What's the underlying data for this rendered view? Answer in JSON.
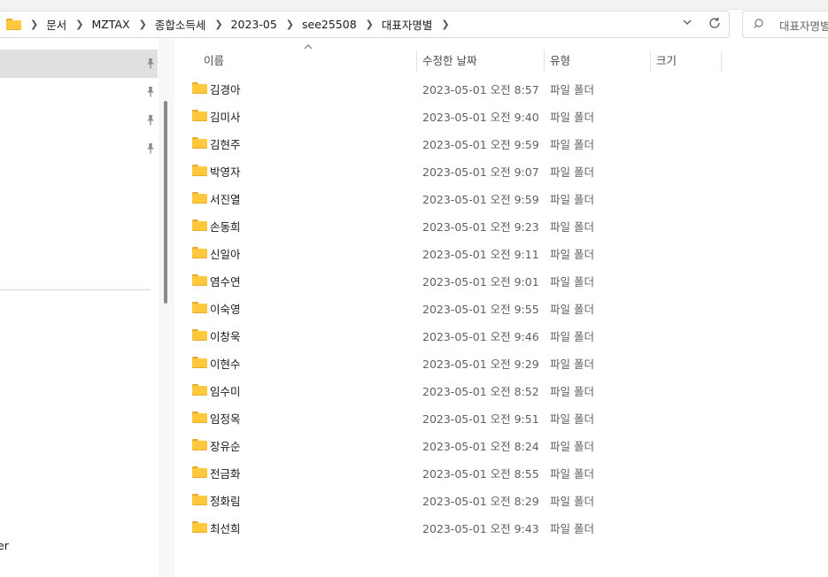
{
  "breadcrumb": [
    "문서",
    "MZTAX",
    "종합소득세",
    "2023-05",
    "see25508",
    "대표자명별"
  ],
  "search": {
    "placeholder": "대표자명별 검색"
  },
  "nav": {
    "partial_label": "er"
  },
  "columns": {
    "name": "이름",
    "date": "수정한 날짜",
    "type": "유형",
    "size": "크기"
  },
  "files": [
    {
      "name": "김경아",
      "date": "2023-05-01 오전 8:57",
      "type": "파일 폴더"
    },
    {
      "name": "김미사",
      "date": "2023-05-01 오전 9:40",
      "type": "파일 폴더"
    },
    {
      "name": "김현주",
      "date": "2023-05-01 오전 9:59",
      "type": "파일 폴더"
    },
    {
      "name": "박영자",
      "date": "2023-05-01 오전 9:07",
      "type": "파일 폴더"
    },
    {
      "name": "서진열",
      "date": "2023-05-01 오전 9:59",
      "type": "파일 폴더"
    },
    {
      "name": "손동희",
      "date": "2023-05-01 오전 9:23",
      "type": "파일 폴더"
    },
    {
      "name": "신일아",
      "date": "2023-05-01 오전 9:11",
      "type": "파일 폴더"
    },
    {
      "name": "염수연",
      "date": "2023-05-01 오전 9:01",
      "type": "파일 폴더"
    },
    {
      "name": "이숙영",
      "date": "2023-05-01 오전 9:55",
      "type": "파일 폴더"
    },
    {
      "name": "이창욱",
      "date": "2023-05-01 오전 9:46",
      "type": "파일 폴더"
    },
    {
      "name": "이현수",
      "date": "2023-05-01 오전 9:29",
      "type": "파일 폴더"
    },
    {
      "name": "임수미",
      "date": "2023-05-01 오전 8:52",
      "type": "파일 폴더"
    },
    {
      "name": "임정옥",
      "date": "2023-05-01 오전 9:51",
      "type": "파일 폴더"
    },
    {
      "name": "장유순",
      "date": "2023-05-01 오전 8:24",
      "type": "파일 폴더"
    },
    {
      "name": "전금화",
      "date": "2023-05-01 오전 8:55",
      "type": "파일 폴더"
    },
    {
      "name": "정화림",
      "date": "2023-05-01 오전 8:29",
      "type": "파일 폴더"
    },
    {
      "name": "최선희",
      "date": "2023-05-01 오전 9:43",
      "type": "파일 폴더"
    }
  ],
  "colors": {
    "folder": "#ffc83d",
    "folder_tab": "#e8a92f",
    "selection": "#e0e0e0",
    "secondary_text": "#5f5f5f"
  },
  "icons": {
    "address_folder": "folder-icon",
    "separator": "chevron-right-icon",
    "dropdown": "chevron-down-icon",
    "refresh": "refresh-icon",
    "search": "search-icon",
    "pin": "pin-icon"
  }
}
